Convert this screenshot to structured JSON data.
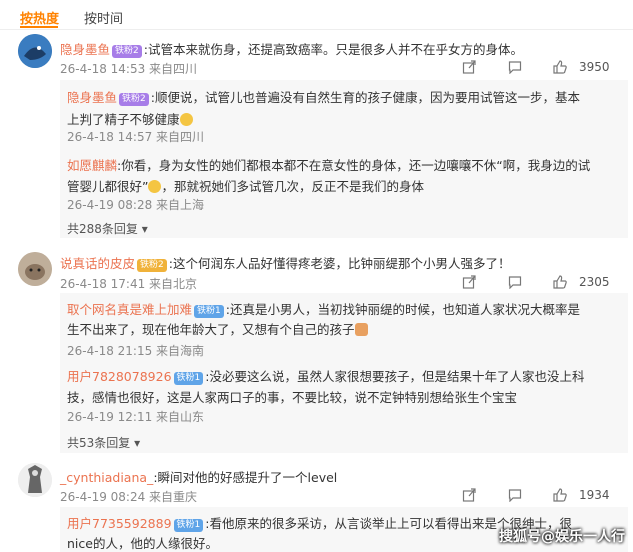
{
  "tabs": {
    "hot": "按热度",
    "time": "按时间"
  },
  "comments": [
    {
      "user": "隐身墨鱼",
      "badge": "铁粉2",
      "text": ":试管本来就伤身，还提高致癌率。只是很多人并不在乎女方的身体。",
      "time": "26-4-18 14:53 来自四川",
      "likes": "3950",
      "replies": [
        {
          "user": "隐身墨鱼",
          "badge": "铁粉2",
          "text": ":顺便说，试管儿也普遍没有自然生育的孩子健康，因为要用试管这一步，基本",
          "text2": "上判了精子不够健康",
          "time": "26-4-18 14:57 来自四川"
        },
        {
          "user": "如愿麒麟",
          "badge": "",
          "text": ":你看，身为女性的她们都根本都不在意女性的身体，还一边嚷嚷不休“啊，我身边的试",
          "text2": "管婴儿都很好”",
          "text2b": "，那就祝她们多试管几次，反正不是我们的身体",
          "time": "26-4-19 08:28 来自上海"
        }
      ],
      "more": "共288条回复"
    },
    {
      "user": "说真话的皮皮",
      "badge": "铁粉2",
      "text": ":这个何润东人品好懂得疼老婆，比钟丽缇那个小男人强多了！",
      "time": "26-4-18 17:41 来自北京",
      "likes": "2305",
      "replies": [
        {
          "user": "取个网名真是难上加难",
          "badge": "铁粉1",
          "text": ":还真是小男人，当初找钟丽缇的时候，也知道人家状况大概率是",
          "text2": "生不出来了，现在他年龄大了，又想有个自己的孩子",
          "time": "26-4-18 21:15 来自海南"
        },
        {
          "user": "用户7828078926",
          "badge": "铁粉1",
          "text": ":没必要这么说，虽然人家很想要孩子，但是结果十年了人家也没上科",
          "text2": "技，感情也很好，这是人家两口子的事，不要比较，说不定钟特别想给张生个宝宝",
          "time": "26-4-19 12:11 来自山东"
        }
      ],
      "more": "共53条回复"
    },
    {
      "user": "_cynthiadiana_",
      "badge": "",
      "text": ":瞬间对他的好感提升了一个level",
      "time": "26-4-19 08:24 来自重庆",
      "likes": "1934",
      "replies": [
        {
          "user": "用户7735592889",
          "badge": "铁粉1",
          "text": ":看他原来的很多采访，从言谈举止上可以看得出来是个很绅士，很",
          "text2": "nice的人，他的人缘很好。"
        }
      ]
    }
  ],
  "watermark": "搜狐号@娱乐一人行",
  "colors": {
    "accent": "#ff8200",
    "username": "#eb7350",
    "meta": "#8a8a8a"
  }
}
